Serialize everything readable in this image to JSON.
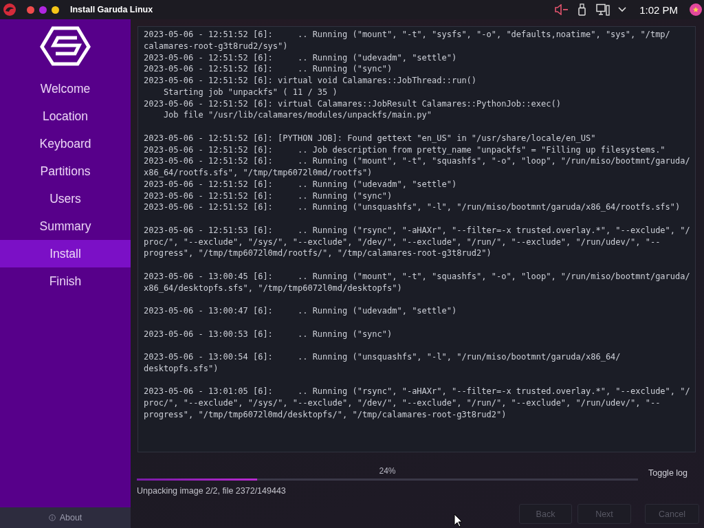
{
  "window": {
    "title": "Install Garuda Linux"
  },
  "tray": {
    "clock": "1:02 PM"
  },
  "sidebar": {
    "items": [
      {
        "label": "Welcome",
        "selected": false
      },
      {
        "label": "Location",
        "selected": false
      },
      {
        "label": "Keyboard",
        "selected": false
      },
      {
        "label": "Partitions",
        "selected": false
      },
      {
        "label": "Users",
        "selected": false
      },
      {
        "label": "Summary",
        "selected": false
      },
      {
        "label": "Install",
        "selected": true
      },
      {
        "label": "Finish",
        "selected": false
      }
    ],
    "about": "About"
  },
  "log": {
    "blocks": [
      {
        "lines": [
          "2023-05-06 - 12:51:52 [6]:     .. Running (\"mount\", \"-t\", \"sysfs\", \"-o\", \"defaults,noatime\", \"sys\", \"/tmp/",
          "calamares-root-g3t8rud2/sys\")",
          "2023-05-06 - 12:51:52 [6]:     .. Running (\"udevadm\", \"settle\")",
          "2023-05-06 - 12:51:52 [6]:     .. Running (\"sync\")",
          "2023-05-06 - 12:51:52 [6]: virtual void Calamares::JobThread::run()",
          "    Starting job \"unpackfs\" ( 11 / 35 )",
          "2023-05-06 - 12:51:52 [6]: virtual Calamares::JobResult Calamares::PythonJob::exec()",
          "    Job file \"/usr/lib/calamares/modules/unpackfs/main.py\""
        ]
      },
      {
        "lines": [
          "2023-05-06 - 12:51:52 [6]: [PYTHON JOB]: Found gettext \"en_US\" in \"/usr/share/locale/en_US\"",
          "2023-05-06 - 12:51:52 [6]:     .. Job description from pretty_name \"unpackfs\" = \"Filling up filesystems.\"",
          "2023-05-06 - 12:51:52 [6]:     .. Running (\"mount\", \"-t\", \"squashfs\", \"-o\", \"loop\", \"/run/miso/bootmnt/garuda/",
          "x86_64/rootfs.sfs\", \"/tmp/tmp6072l0md/rootfs\")",
          "2023-05-06 - 12:51:52 [6]:     .. Running (\"udevadm\", \"settle\")",
          "2023-05-06 - 12:51:52 [6]:     .. Running (\"sync\")",
          "2023-05-06 - 12:51:52 [6]:     .. Running (\"unsquashfs\", \"-l\", \"/run/miso/bootmnt/garuda/x86_64/rootfs.sfs\")"
        ]
      },
      {
        "lines": [
          "2023-05-06 - 12:51:53 [6]:     .. Running (\"rsync\", \"-aHAXr\", \"--filter=-x trusted.overlay.*\", \"--exclude\", \"/",
          "proc/\", \"--exclude\", \"/sys/\", \"--exclude\", \"/dev/\", \"--exclude\", \"/run/\", \"--exclude\", \"/run/udev/\", \"--",
          "progress\", \"/tmp/tmp6072l0md/rootfs/\", \"/tmp/calamares-root-g3t8rud2\")"
        ]
      },
      {
        "lines": [
          "2023-05-06 - 13:00:45 [6]:     .. Running (\"mount\", \"-t\", \"squashfs\", \"-o\", \"loop\", \"/run/miso/bootmnt/garuda/",
          "x86_64/desktopfs.sfs\", \"/tmp/tmp6072l0md/desktopfs\")"
        ]
      },
      {
        "lines": [
          "2023-05-06 - 13:00:47 [6]:     .. Running (\"udevadm\", \"settle\")"
        ]
      },
      {
        "lines": [
          "2023-05-06 - 13:00:53 [6]:     .. Running (\"sync\")"
        ]
      },
      {
        "lines": [
          "2023-05-06 - 13:00:54 [6]:     .. Running (\"unsquashfs\", \"-l\", \"/run/miso/bootmnt/garuda/x86_64/",
          "desktopfs.sfs\")"
        ]
      },
      {
        "lines": [
          "2023-05-06 - 13:01:05 [6]:     .. Running (\"rsync\", \"-aHAXr\", \"--filter=-x trusted.overlay.*\", \"--exclude\", \"/",
          "proc/\", \"--exclude\", \"/sys/\", \"--exclude\", \"/dev/\", \"--exclude\", \"/run/\", \"--exclude\", \"/run/udev/\", \"--",
          "progress\", \"/tmp/tmp6072l0md/desktopfs/\", \"/tmp/calamares-root-g3t8rud2\")"
        ]
      }
    ]
  },
  "progress": {
    "percent": "24%",
    "level": 0.24,
    "status": "Unpacking image 2/2, file 2372/149443",
    "toggle": "Toggle log"
  },
  "buttons": [
    {
      "label": "Back",
      "disabled": true
    },
    {
      "label": "Next",
      "disabled": true
    },
    {
      "label": "Cancel",
      "disabled": true
    }
  ]
}
